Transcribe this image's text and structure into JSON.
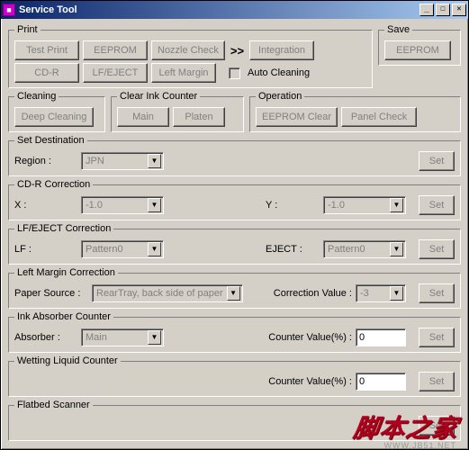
{
  "window": {
    "title": "Service Tool"
  },
  "titlebar_buttons": {
    "min": "_",
    "max": "☐",
    "close": "✕"
  },
  "print": {
    "legend": "Print",
    "buttons": {
      "test_print": "Test Print",
      "eeprom": "EEPROM",
      "nozzle_check": "Nozzle Check",
      "integration": "Integration",
      "cd_r": "CD-R",
      "lf_eject": "LF/EJECT",
      "left_margin": "Left Margin"
    },
    "arrows": ">>",
    "auto_cleaning_label": "Auto Cleaning"
  },
  "save": {
    "legend": "Save",
    "eeprom": "EEPROM"
  },
  "cleaning": {
    "legend": "Cleaning",
    "deep_cleaning": "Deep Cleaning"
  },
  "clear_ink": {
    "legend": "Clear Ink Counter",
    "main": "Main",
    "platen": "Platen"
  },
  "operation": {
    "legend": "Operation",
    "eeprom_clear": "EEPROM Clear",
    "panel_check": "Panel Check"
  },
  "set_dest": {
    "legend": "Set Destination",
    "region_label": "Region :",
    "region_value": "JPN",
    "set": "Set"
  },
  "cdr_corr": {
    "legend": "CD-R Correction",
    "x_label": "X :",
    "x_value": "-1.0",
    "y_label": "Y :",
    "y_value": "-1.0",
    "set": "Set"
  },
  "lfeject_corr": {
    "legend": "LF/EJECT Correction",
    "lf_label": "LF :",
    "lf_value": "Pattern0",
    "eject_label": "EJECT :",
    "eject_value": "Pattern0",
    "set": "Set"
  },
  "left_margin_corr": {
    "legend": "Left Margin Correction",
    "source_label": "Paper Source :",
    "source_value": "RearTray, back side of paper",
    "corr_label": "Correction Value :",
    "corr_value": "-3",
    "set": "Set"
  },
  "ink_absorber": {
    "legend": "Ink Absorber Counter",
    "absorber_label": "Absorber :",
    "absorber_value": "Main",
    "counter_label": "Counter Value(%) :",
    "counter_value": "0",
    "set": "Set"
  },
  "wetting": {
    "legend": "Wetting Liquid Counter",
    "counter_label": "Counter Value(%) :",
    "counter_value": "0",
    "set": "Set"
  },
  "flatbed": {
    "legend": "Flatbed Scanner",
    "set": "Set"
  },
  "watermark": {
    "main": "脚本之家",
    "sub": "WWW.JB51.NET"
  }
}
